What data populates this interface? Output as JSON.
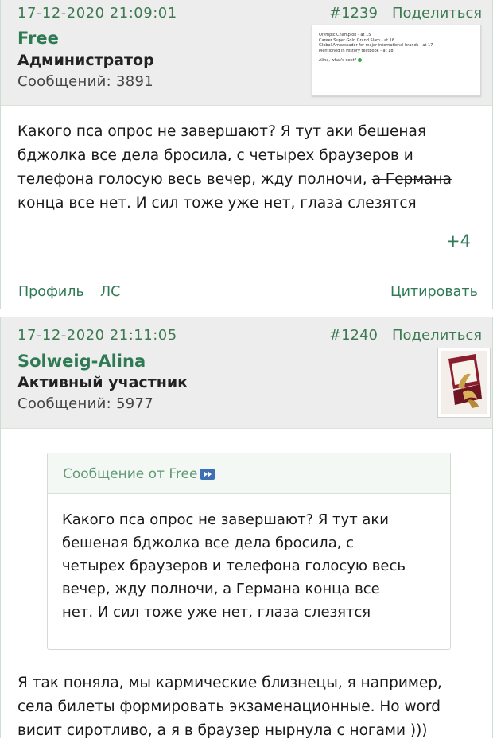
{
  "posts": [
    {
      "date": "17-12-2020 21:09:01",
      "number": "#1239",
      "share": "Поделиться",
      "username": "Free",
      "role": "Администратор",
      "messages": "Сообщений: 3891",
      "avatar_text": [
        "Olympic Champion - at 15",
        "Career Super Gold Grand Slam - at 16",
        "Global Ambassador for major international brands - at 17",
        "Mentioned in History textbook - at 18",
        "Alina, what's next?"
      ],
      "body_lines": [
        "Какого пса опрос не завершают? Я тут аки бешеная",
        "бджолка все дела бросила, с четырех браузеров и"
      ],
      "body_line3_before": "телефона голосую весь вечер, жду полночи, ",
      "body_line3_strike": "а Германа",
      "body_line4": "конца все нет. И сил тоже уже нет, глаза слезятся",
      "reactions": "+4",
      "profile": "Профиль",
      "pm": "ЛС",
      "quote": "Цитировать"
    },
    {
      "date": "17-12-2020 21:11:05",
      "number": "#1240",
      "share": "Поделиться",
      "username": "Solweig-Alina",
      "role": "Активный участник",
      "messages": "Сообщений: 5977",
      "quote_from": "Сообщение от Free",
      "quote_lines": [
        "Какого пса опрос не завершают? Я тут аки",
        "бешеная бджолка все дела бросила, с",
        "четырех браузеров и телефона голосую весь"
      ],
      "quote_line4_before": "вечер, жду полночи, ",
      "quote_line4_strike": "а Германа",
      "quote_line4_after": " конца все",
      "quote_line5": "нет. И сил тоже уже нет, глаза слезятся",
      "body_lines": [
        "Я так поняла, мы кармические близнецы, я например,",
        "села билеты формировать экзаменационные. Но word",
        "висит сиротливо, а я в браузер нырнула с ногами )))"
      ]
    }
  ],
  "colors": {
    "accent": "#2f7a55",
    "header_bg": "#ededed",
    "border": "#cfdccf"
  }
}
